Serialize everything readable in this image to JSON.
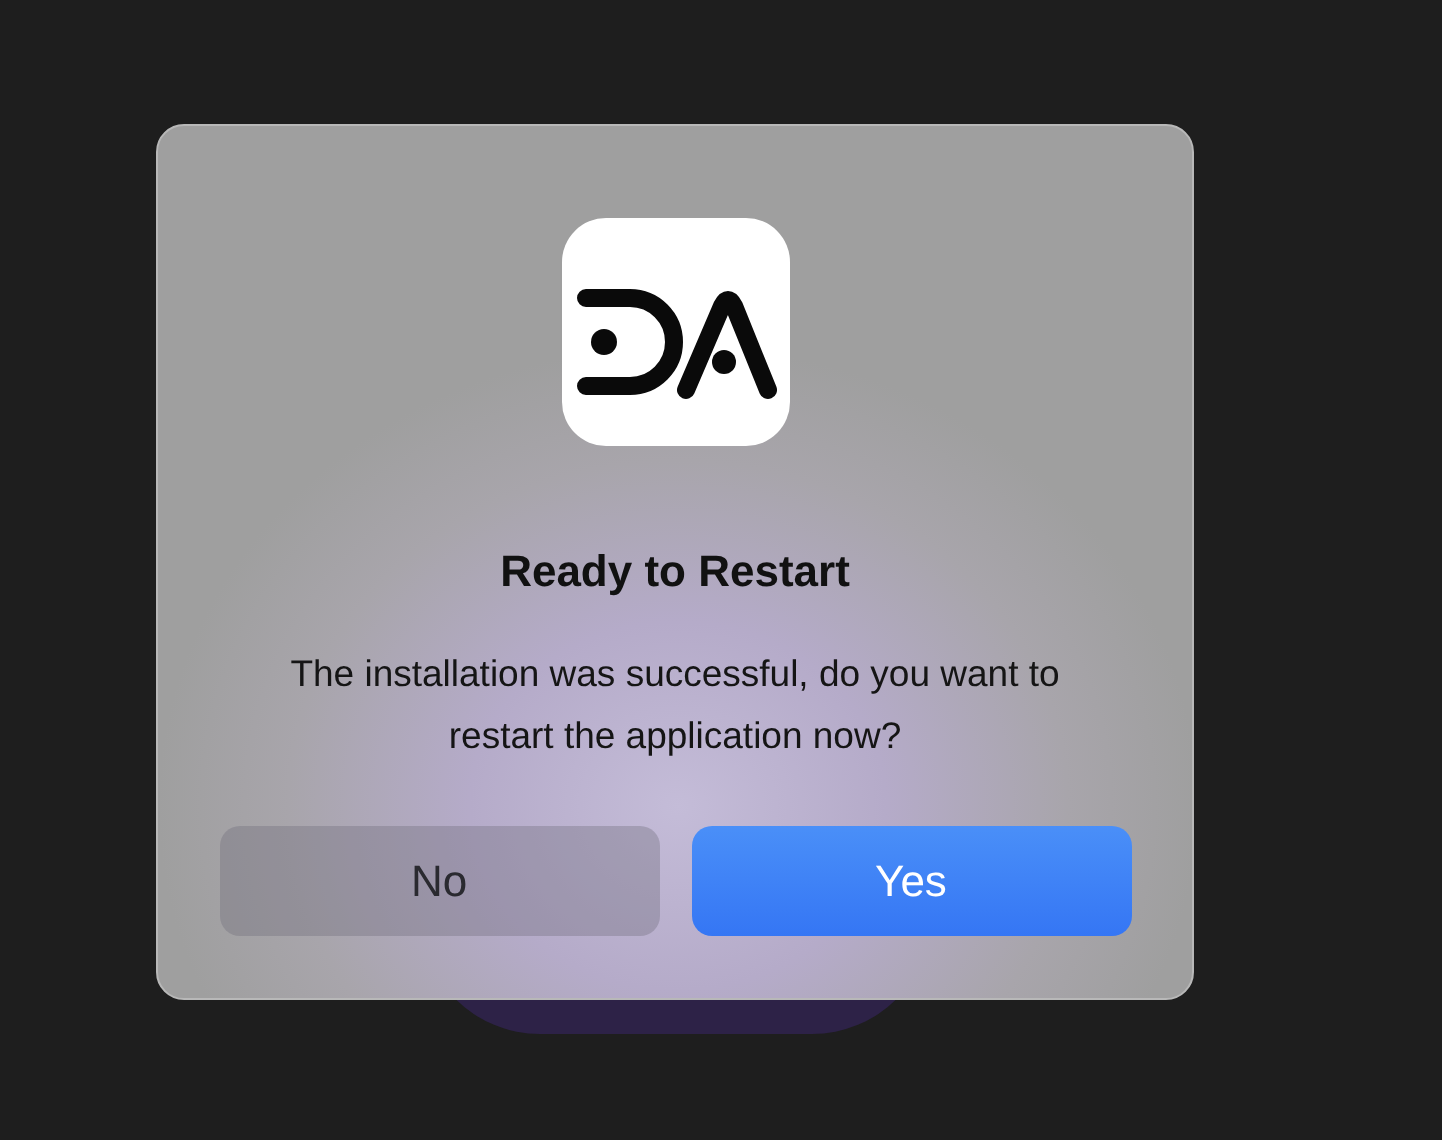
{
  "dialog": {
    "title": "Ready to Restart",
    "message": "The installation was successful, do you want to restart the application now?",
    "buttons": [
      {
        "label": "No",
        "kind": "secondary"
      },
      {
        "label": "Yes",
        "kind": "primary"
      }
    ]
  }
}
